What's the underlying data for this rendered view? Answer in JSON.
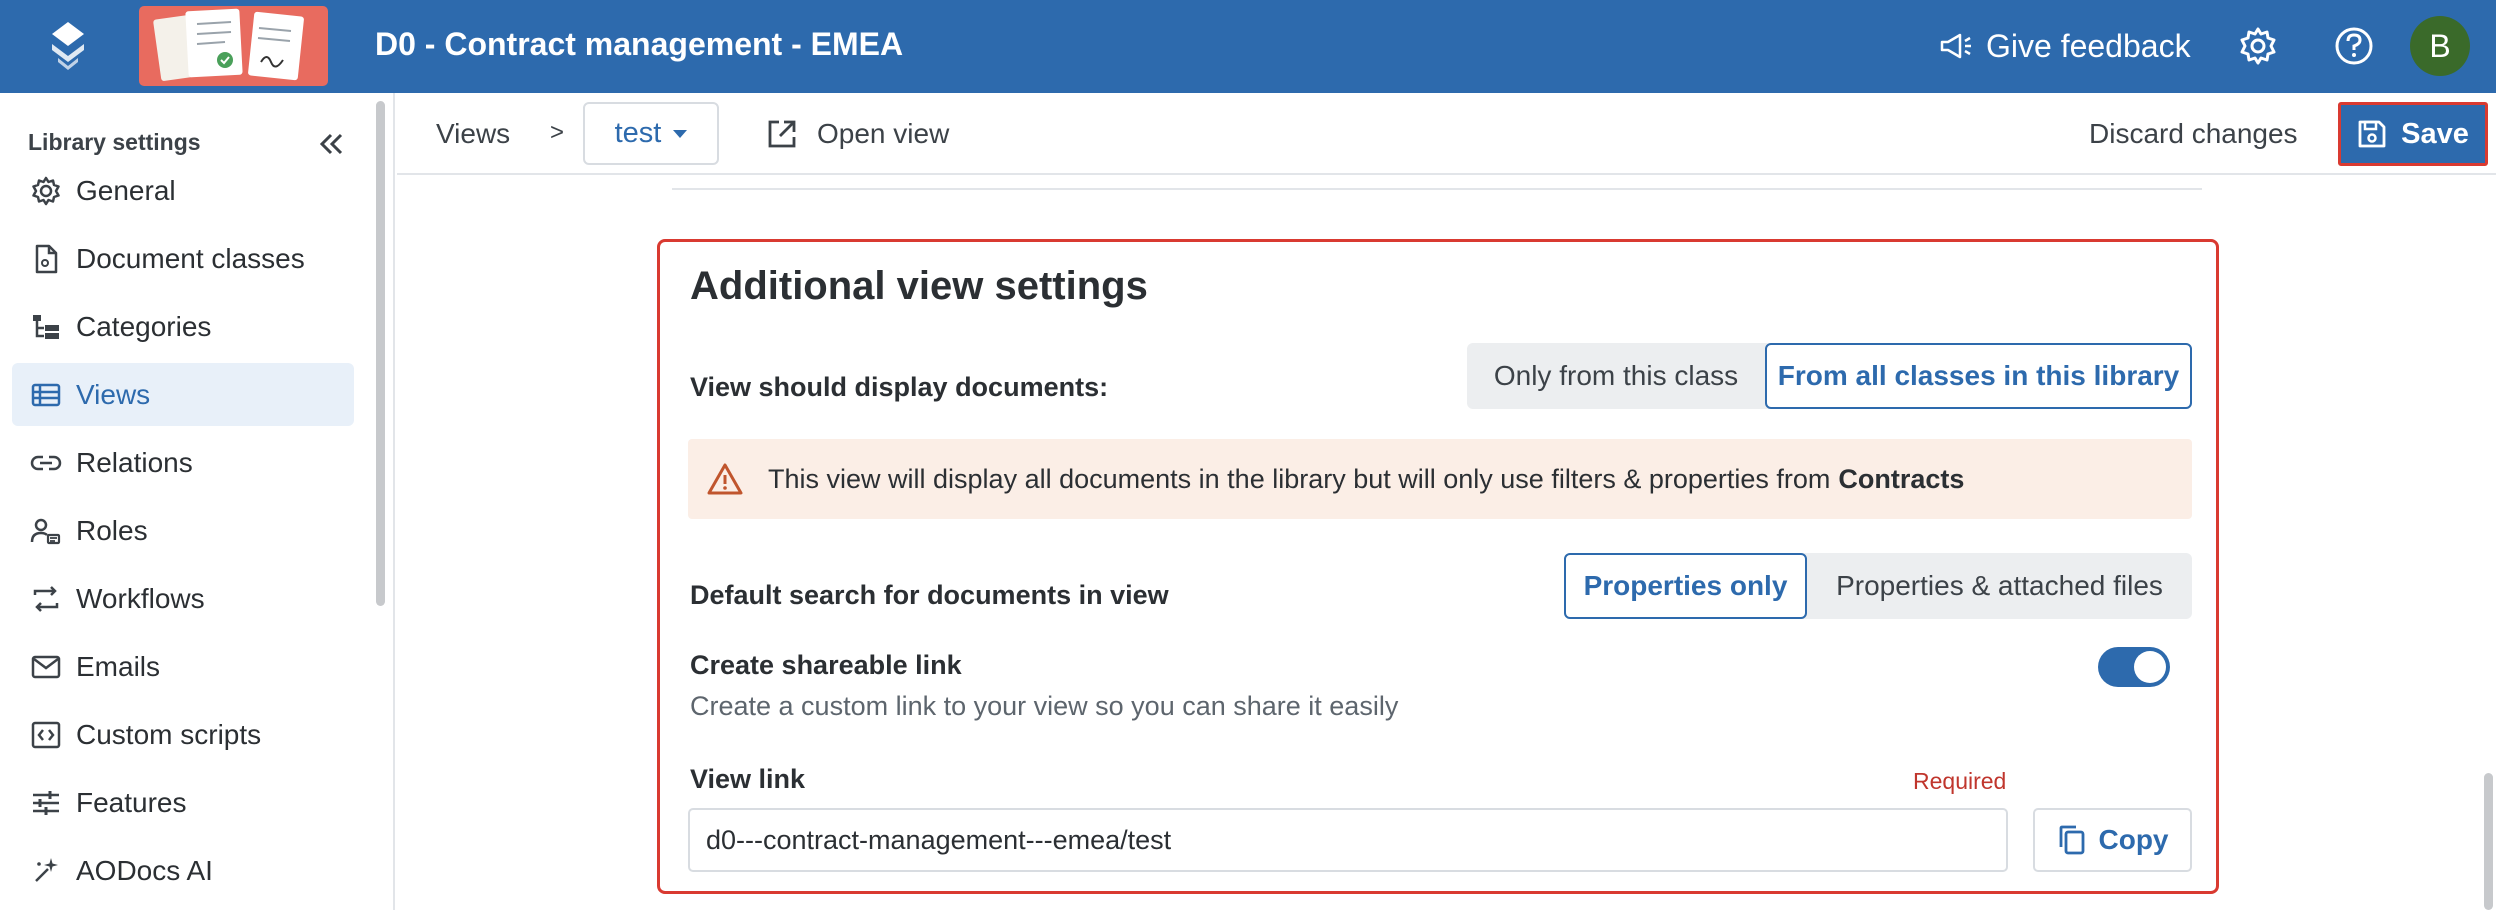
{
  "header": {
    "title": "D0 - Contract management - EMEA",
    "feedback_label": "Give feedback",
    "avatar_initial": "B",
    "brand_color": "#2d6aad"
  },
  "sidebar": {
    "title": "Library settings",
    "items": [
      {
        "label": "General",
        "icon": "gear-icon"
      },
      {
        "label": "Document classes",
        "icon": "document-classes-icon"
      },
      {
        "label": "Categories",
        "icon": "categories-icon"
      },
      {
        "label": "Views",
        "icon": "views-icon",
        "active": true
      },
      {
        "label": "Relations",
        "icon": "link-icon"
      },
      {
        "label": "Roles",
        "icon": "roles-icon"
      },
      {
        "label": "Workflows",
        "icon": "workflow-icon"
      },
      {
        "label": "Emails",
        "icon": "mail-icon"
      },
      {
        "label": "Custom scripts",
        "icon": "code-icon"
      },
      {
        "label": "Features",
        "icon": "sliders-icon"
      },
      {
        "label": "AODocs AI",
        "icon": "sparkle-icon"
      }
    ]
  },
  "toolbar": {
    "breadcrumb_root": "Views",
    "breadcrumb_separator": ">",
    "current_view": "test",
    "open_view_label": "Open view",
    "discard_label": "Discard changes",
    "save_label": "Save"
  },
  "panel": {
    "title": "Additional view settings",
    "display_label": "View should display documents:",
    "display_options": [
      "Only from this class",
      "From all classes in this library"
    ],
    "display_selected": "From all classes in this library",
    "warning_text": "This view will display all documents in the library but will only use filters & properties from",
    "warning_class": "Contracts",
    "search_label": "Default search for documents in view",
    "search_options": [
      "Properties only",
      "Properties & attached files"
    ],
    "search_selected": "Properties only",
    "share_label": "Create shareable link",
    "share_description": "Create a custom link to your view so you can share it easily",
    "share_enabled": true,
    "link_label": "View link",
    "required_label": "Required",
    "link_value": "d0---contract-management---emea/test",
    "copy_label": "Copy"
  }
}
